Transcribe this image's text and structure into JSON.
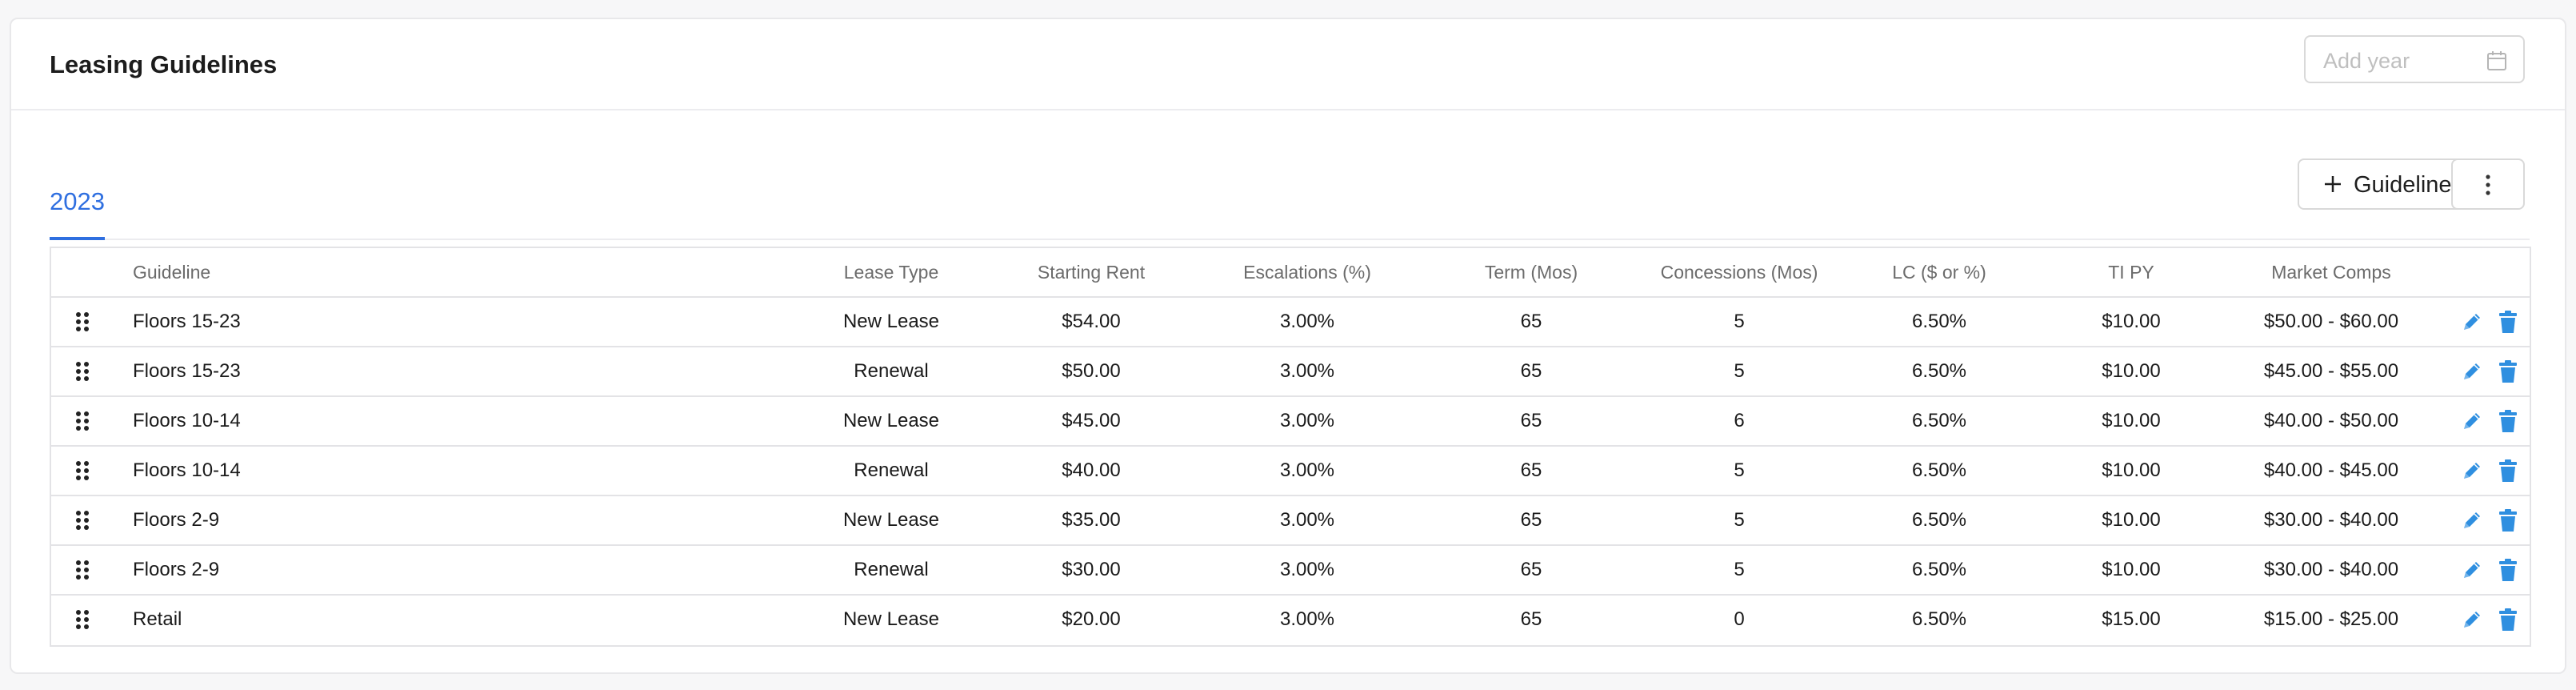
{
  "page": {
    "title": "Leasing Guidelines"
  },
  "year_picker": {
    "placeholder": "Add year",
    "icon": "calendar-icon"
  },
  "tabs": [
    {
      "label": "2023",
      "active": true
    }
  ],
  "actions": {
    "add_label": "Guideline",
    "add_icon": "plus-icon",
    "more_icon": "more-vertical-icon"
  },
  "colors": {
    "accent": "#2f6fe0",
    "action_icon": "#2f8fe0"
  },
  "table": {
    "headers": {
      "guideline": "Guideline",
      "lease_type": "Lease Type",
      "starting_rent": "Starting Rent",
      "escalations": "Escalations (%)",
      "term": "Term (Mos)",
      "concessions": "Concessions (Mos)",
      "lc": "LC ($ or %)",
      "ti_py": "TI PY",
      "market_comps": "Market Comps"
    },
    "rows": [
      {
        "guideline": "Floors 15-23",
        "lease_type": "New Lease",
        "starting_rent": "$54.00",
        "escalations": "3.00%",
        "term": "65",
        "concessions": "5",
        "lc": "6.50%",
        "ti_py": "$10.00",
        "market_comps": "$50.00 - $60.00"
      },
      {
        "guideline": "Floors 15-23",
        "lease_type": "Renewal",
        "starting_rent": "$50.00",
        "escalations": "3.00%",
        "term": "65",
        "concessions": "5",
        "lc": "6.50%",
        "ti_py": "$10.00",
        "market_comps": "$45.00 - $55.00"
      },
      {
        "guideline": "Floors 10-14",
        "lease_type": "New Lease",
        "starting_rent": "$45.00",
        "escalations": "3.00%",
        "term": "65",
        "concessions": "6",
        "lc": "6.50%",
        "ti_py": "$10.00",
        "market_comps": "$40.00 - $50.00"
      },
      {
        "guideline": "Floors 10-14",
        "lease_type": "Renewal",
        "starting_rent": "$40.00",
        "escalations": "3.00%",
        "term": "65",
        "concessions": "5",
        "lc": "6.50%",
        "ti_py": "$10.00",
        "market_comps": "$40.00 - $45.00"
      },
      {
        "guideline": "Floors 2-9",
        "lease_type": "New Lease",
        "starting_rent": "$35.00",
        "escalations": "3.00%",
        "term": "65",
        "concessions": "5",
        "lc": "6.50%",
        "ti_py": "$10.00",
        "market_comps": "$30.00 - $40.00"
      },
      {
        "guideline": "Floors 2-9",
        "lease_type": "Renewal",
        "starting_rent": "$30.00",
        "escalations": "3.00%",
        "term": "65",
        "concessions": "5",
        "lc": "6.50%",
        "ti_py": "$10.00",
        "market_comps": "$30.00 - $40.00"
      },
      {
        "guideline": "Retail",
        "lease_type": "New Lease",
        "starting_rent": "$20.00",
        "escalations": "3.00%",
        "term": "65",
        "concessions": "0",
        "lc": "6.50%",
        "ti_py": "$15.00",
        "market_comps": "$15.00 - $25.00"
      }
    ]
  }
}
